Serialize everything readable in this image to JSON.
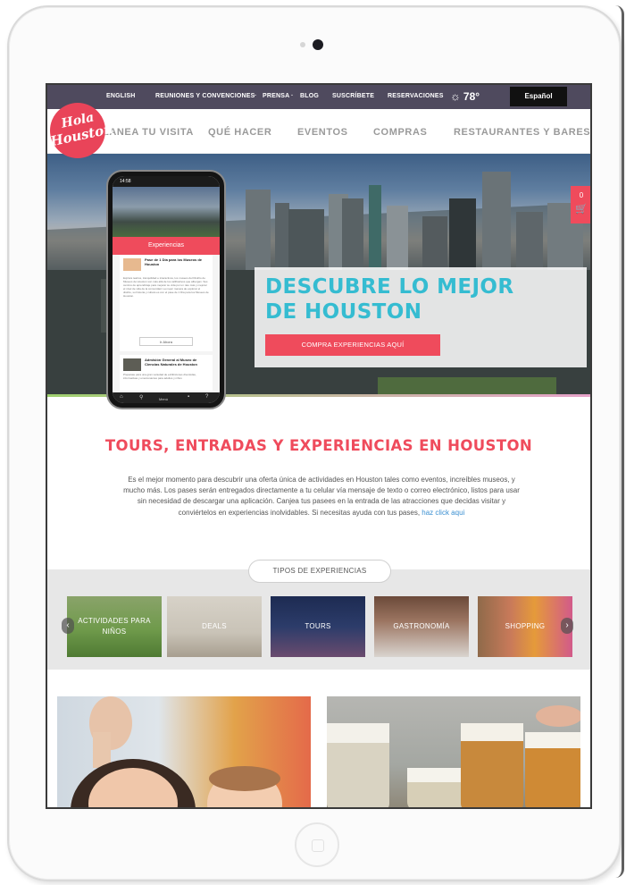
{
  "top_bar": {
    "english": "ENGLISH",
    "reuniones": "REUNIONES Y CONVENCIONES",
    "prensa": "PRENSA",
    "blog": "BLOG",
    "suscribete": "SUSCRÍBETE",
    "reservaciones": "RESERVACIONES",
    "separator": "·",
    "temperature": "78°",
    "language_button": "Español"
  },
  "logo": {
    "line1": "Hola",
    "line2": "Houston"
  },
  "nav": {
    "items": [
      "LANEA TU VISITA",
      "QUÉ HACER",
      "EVENTOS",
      "COMPRAS",
      "RESTAURANTES Y BARES"
    ]
  },
  "hero": {
    "title": "DESCUBRE LO MEJOR DE HOUSTON",
    "cta_button": "COMPRA EXPERIENCIAS AQUÍ",
    "cart_count": "0"
  },
  "phone": {
    "time": "14:58",
    "heading": "Experiencias",
    "card1_title": "Pase de 1 Día para los Museos de Houston",
    "card1_desc": "Explora teatros, tranquilidad e interactivos, los museos del Distrito de Museos de Houston son más allá de los calificativos que albergan. Sus centros de aprendizaje para mejorar su vida por un rato más y mejorar el nivel de vida de la comunidad. La mejor manera de explorar el distrito, su historia y cultura es con el pase de 1 Día para los Museos de Houston.",
    "card1_button": "Ir Ahora",
    "card2_title": "Admisión General al Museo de Ciencias Naturales de Houston",
    "card2_desc": "Preparate para una gran variedad de exhibiciones diversidas, informativas y emocionantes para adultos y niños",
    "nav_label": "Menú"
  },
  "section": {
    "title": "TOURS, ENTRADAS Y EXPERIENCIAS EN HOUSTON",
    "text": "Es el mejor momento para descubrir una oferta única de actividades en Houston tales como eventos, increíbles museos, y mucho más. Los pases serán entregados directamente a tu celular vía mensaje de texto o correo electrónico, listos para usar sin necesidad de descargar una aplicación. Canjea tus pasees en la entrada de las atracciones que decidas visitar y conviértelos en experiencias inolvidables. Si necesitas ayuda con tus pases, ",
    "link": "haz click aqui"
  },
  "experiences": {
    "label": "TIPOS DE EXPERIENCIAS",
    "tiles": [
      "ACTIVIDADES PARA NIÑOS",
      "DEALS",
      "TOURS",
      "GASTRONOMÍA",
      "SHOPPING"
    ],
    "prev": "‹",
    "next": "›"
  },
  "icons": {
    "weather": "partly-cloudy-icon",
    "cart": "cart-icon"
  },
  "colors": {
    "brand_red": "#ef4b5c",
    "hero_title": "#35bcd1",
    "top_bar": "#4f4a5e"
  }
}
